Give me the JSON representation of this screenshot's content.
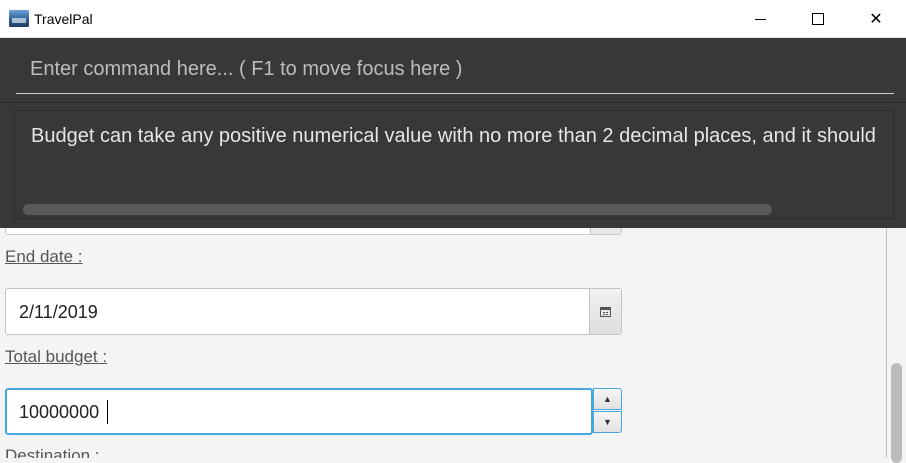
{
  "window": {
    "title": "TravelPal",
    "icon": "travelpal-logo-icon",
    "controls": {
      "minimize": "minimize-icon",
      "maximize": "maximize-icon",
      "close_label": "✕"
    }
  },
  "command": {
    "placeholder": "Enter command here... ( F1 to move focus here )",
    "value": ""
  },
  "result": {
    "message": "Budget can take any positive numerical value with no more than 2 decimal places, and it should"
  },
  "form": {
    "end_date_label": "End date :",
    "end_date_value": "2/11/2019",
    "calendar_icon": "calendar-icon",
    "total_budget_label": "Total budget :",
    "total_budget_value": "10000000",
    "spinner_up": "▲",
    "spinner_down": "▼",
    "destination_label": "Destination :"
  },
  "colors": {
    "command_background": "#383838",
    "focus_accent": "#45a6e0"
  }
}
